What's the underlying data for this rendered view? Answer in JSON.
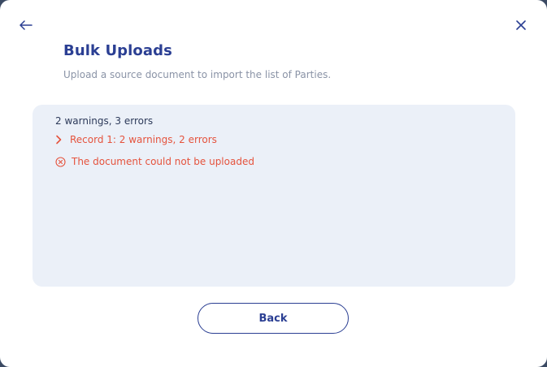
{
  "header": {
    "back_icon": "arrow-left-icon",
    "close_icon": "close-icon",
    "title": "Bulk Uploads",
    "subtitle": "Upload a source document to import the list of Parties."
  },
  "results": {
    "summary": "2 warnings, 3 errors",
    "records": [
      {
        "label": "Record 1: 2 warnings, 2 errors",
        "icon": "chevron-right-icon"
      }
    ],
    "error_message": "The document could not be uploaded",
    "error_icon": "error-circle-icon"
  },
  "footer": {
    "back_label": "Back"
  },
  "colors": {
    "primary": "#2b3f93",
    "error": "#e5533d",
    "panel_bg": "#ebf0f8",
    "muted_text": "#8a93a6"
  }
}
